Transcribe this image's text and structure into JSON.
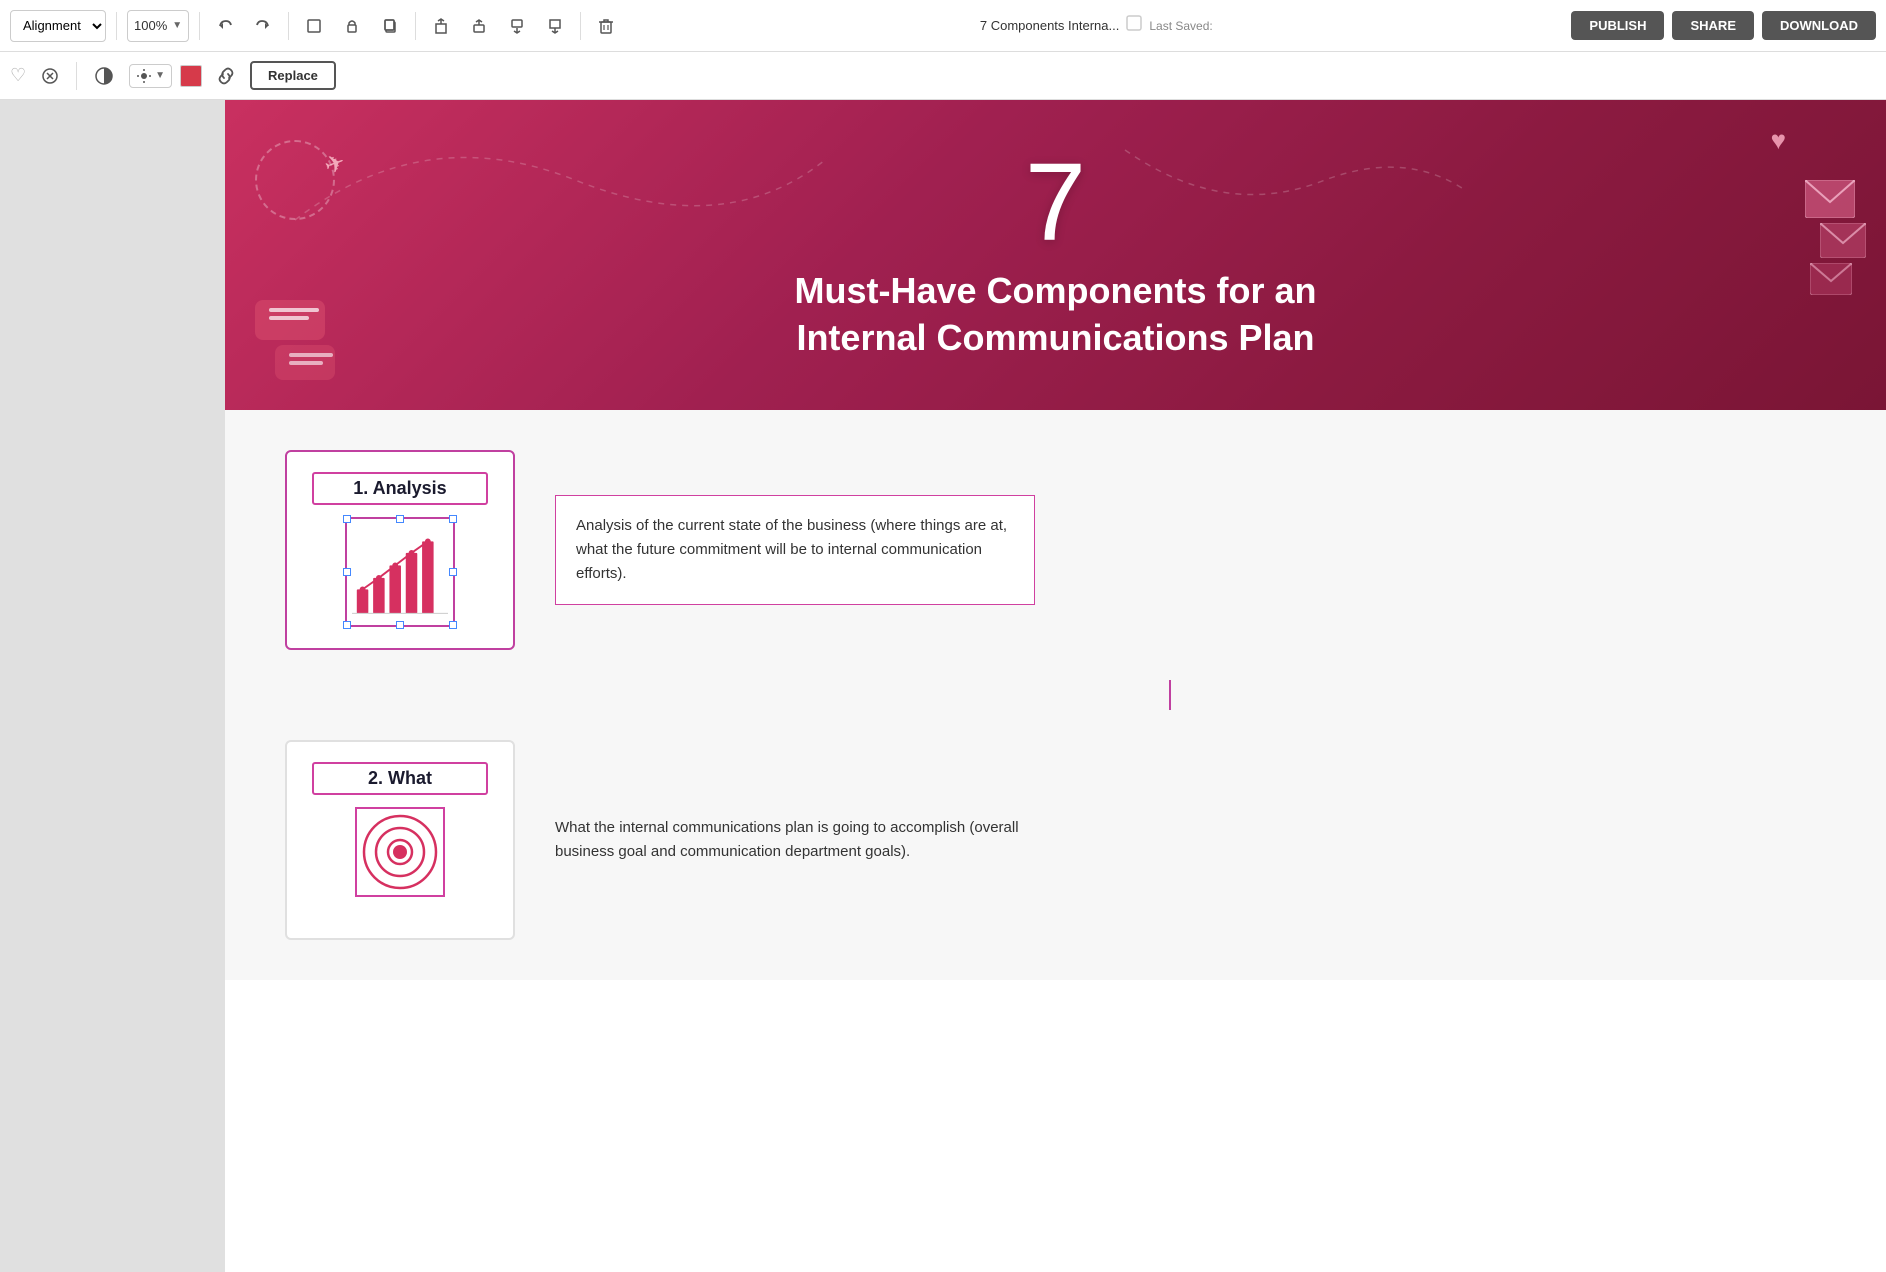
{
  "toolbar": {
    "alignment_label": "Alignment",
    "zoom_label": "100%",
    "doc_title": "7 Components Interna...",
    "last_saved_label": "Last Saved:",
    "publish_label": "PUBLISH",
    "share_label": "SHARE",
    "download_label": "DOWNLOAD",
    "replace_label": "Replace"
  },
  "hero": {
    "number": "7",
    "title_line1": "Must-Have Components for an",
    "title_line2": "Internal Communications Plan"
  },
  "cards": [
    {
      "id": 1,
      "title": "1. Analysis",
      "description": "Analysis of the current state of the business (where things are at, what the future commitment will be to internal communication efforts).",
      "has_border": true
    },
    {
      "id": 2,
      "title": "2. What",
      "description": "What the internal communications plan is going to accomplish (overall business goal and communication department goals).",
      "has_border": false
    }
  ]
}
